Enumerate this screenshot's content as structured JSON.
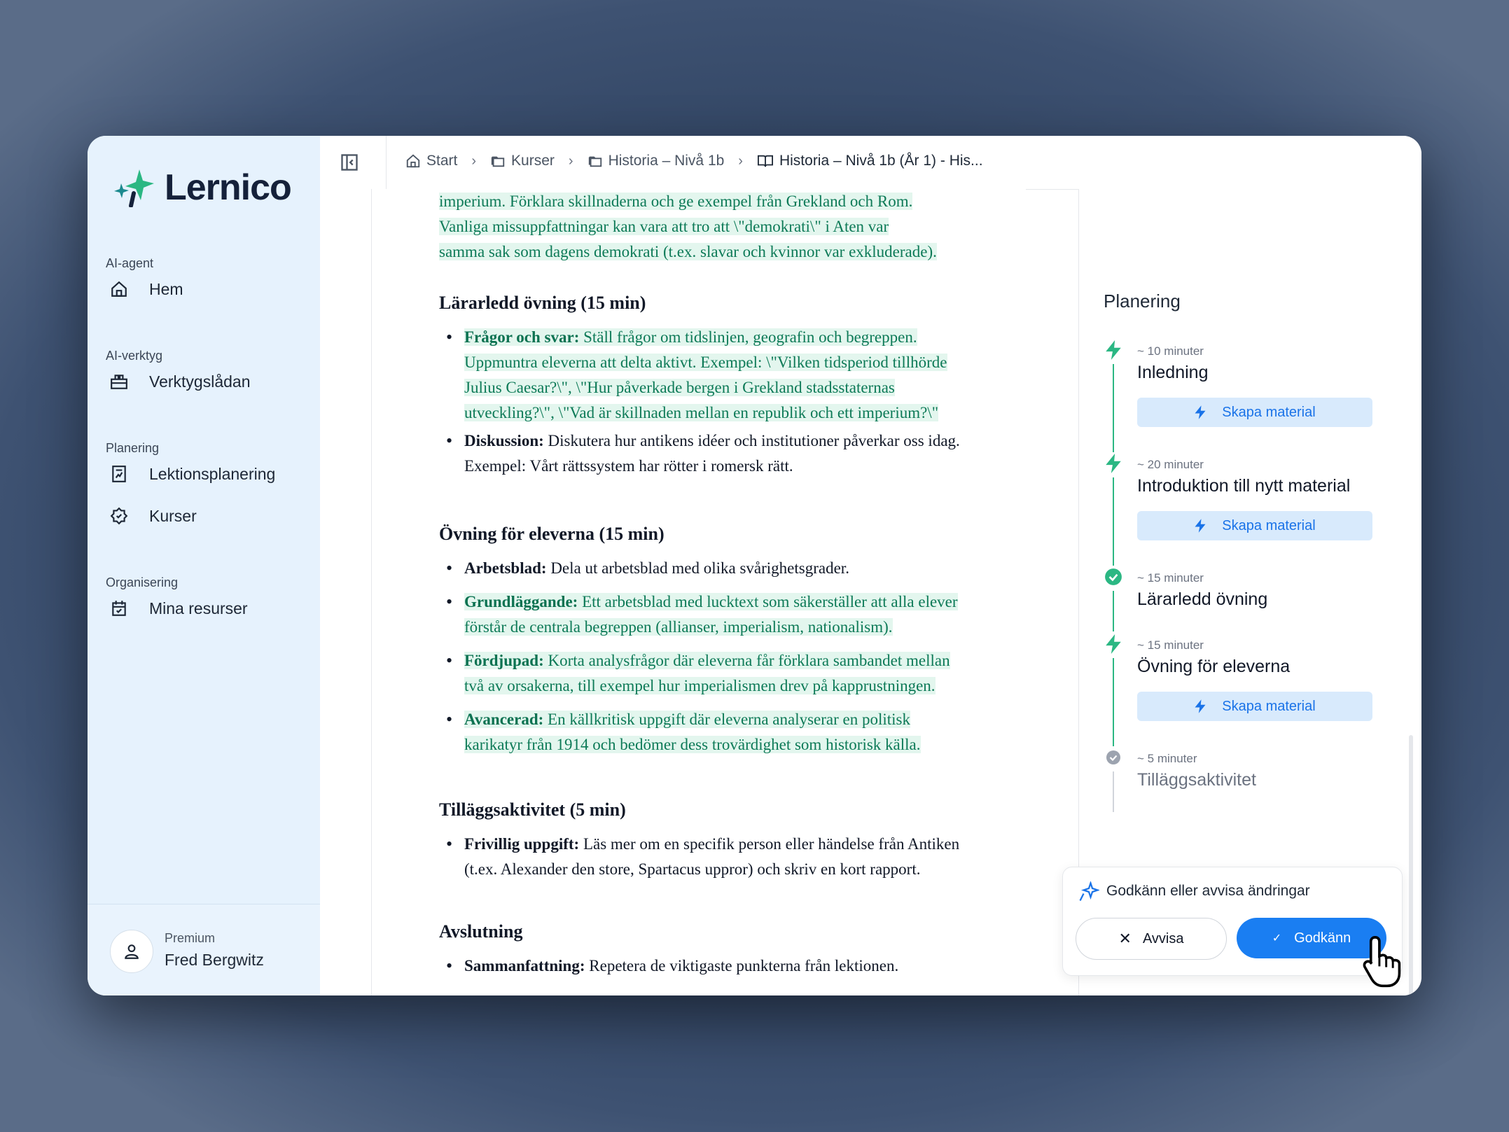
{
  "app": {
    "name": "Lernico"
  },
  "breadcrumbs": [
    {
      "label": "Start"
    },
    {
      "label": "Kurser"
    },
    {
      "label": "Historia – Nivå 1b"
    },
    {
      "label": "Historia – Nivå 1b (År 1) - His..."
    }
  ],
  "sidebar": {
    "sections": [
      {
        "title": "AI-agent",
        "items": [
          {
            "label": "Hem",
            "icon": "home-icon"
          }
        ]
      },
      {
        "title": "AI-verktyg",
        "items": [
          {
            "label": "Verktygslådan",
            "icon": "toolbox-icon"
          }
        ]
      },
      {
        "title": "Planering",
        "items": [
          {
            "label": "Lektionsplanering",
            "icon": "lesson-plan-icon"
          },
          {
            "label": "Kurser",
            "icon": "gear-icon"
          }
        ]
      },
      {
        "title": "Organisering",
        "items": [
          {
            "label": "Mina resurser",
            "icon": "calendar-icon"
          }
        ]
      }
    ],
    "user": {
      "plan": "Premium",
      "name": "Fred Bergwitz"
    }
  },
  "document": {
    "intro_lines": [
      "imperium. Förklara skillnaderna och ge exempel från Grekland och Rom.",
      "Vanliga missuppfattningar kan vara att tro att \\\"demokrati\\\" i Aten var",
      "samma sak som dagens demokrati (t.ex. slavar och kvinnor var exkluderade)."
    ],
    "sections": [
      {
        "heading": "Lärarledd övning (15 min)",
        "bullets": [
          {
            "bold": "Frågor och svar:",
            "lines": [
              " Ställ frågor om tidslinjen, geografin och begreppen.",
              "Uppmuntra eleverna att delta aktivt. Exempel: \\\"Vilken tidsperiod tillhörde",
              "Julius Caesar?\\\", \\\"Hur påverkade bergen i Grekland stadsstaternas",
              "utveckling?\\\", \\\"Vad är skillnaden mellan en republik och ett imperium?\\\""
            ]
          },
          {
            "bold": "Diskussion:",
            "lines": [
              " Diskutera hur antikens idéer och institutioner påverkar oss idag.",
              "Exempel: Vårt rättssystem har rötter i romersk rätt."
            ]
          }
        ]
      },
      {
        "heading": "Övning för eleverna (15 min)",
        "bullets": [
          {
            "bold": "Arbetsblad:",
            "lines": [
              " Dela ut arbetsblad med olika svårighetsgrader."
            ]
          },
          {
            "bold": "Grundläggande:",
            "lines": [
              " Ett arbetsblad med lucktext som säkerställer att alla elever",
              "förstår de centrala begreppen (allianser, imperialism, nationalism)."
            ]
          },
          {
            "bold": "Fördjupad:",
            "lines": [
              " Korta analysfrågor där eleverna får förklara sambandet mellan",
              "två av orsakerna, till exempel hur imperialismen drev på kapprustningen."
            ]
          },
          {
            "bold": "Avancerad:",
            "lines": [
              " En källkritisk uppgift där eleverna analyserar en politisk",
              "karikatyr från 1914 och bedömer dess trovärdighet som historisk källa."
            ]
          }
        ]
      },
      {
        "heading": "Tilläggsaktivitet (5 min)",
        "bullets": [
          {
            "bold": "Frivillig uppgift:",
            "lines": [
              " Läs mer om en specifik person eller händelse från Antiken",
              "(t.ex. Alexander den store, Spartacus uppror) och skriv en kort rapport."
            ]
          }
        ]
      },
      {
        "heading": "Avslutning",
        "bullets": [
          {
            "bold": "Sammanfattning:",
            "lines": [
              " Repetera de viktigaste punkterna från lektionen."
            ]
          }
        ]
      }
    ]
  },
  "planning": {
    "title": "Planering",
    "steps": [
      {
        "time": "~ 10 minuter",
        "name": "Inledning",
        "action": "Skapa material",
        "status": "lightning"
      },
      {
        "time": "~ 20 minuter",
        "name": "Introduktion till nytt material",
        "action": "Skapa material",
        "status": "lightning"
      },
      {
        "time": "~ 15 minuter",
        "name": "Lärarledd övning",
        "action": "",
        "status": "done"
      },
      {
        "time": "~ 15 minuter",
        "name": "Övning för eleverna",
        "action": "Skapa material",
        "status": "lightning"
      },
      {
        "time": "~ 5 minuter",
        "name": "Tilläggsaktivitet",
        "action": "",
        "status": "pending"
      }
    ]
  },
  "approval": {
    "title": "Godkänn eller avvisa ändringar",
    "reject_label": "Avvisa",
    "accept_label": "Godkänn"
  },
  "colors": {
    "accent_green": "#2bb783",
    "highlight_bg": "#e3f6ee",
    "primary_blue": "#1a7ef2",
    "sidebar_bg": "#e6f2fd"
  }
}
